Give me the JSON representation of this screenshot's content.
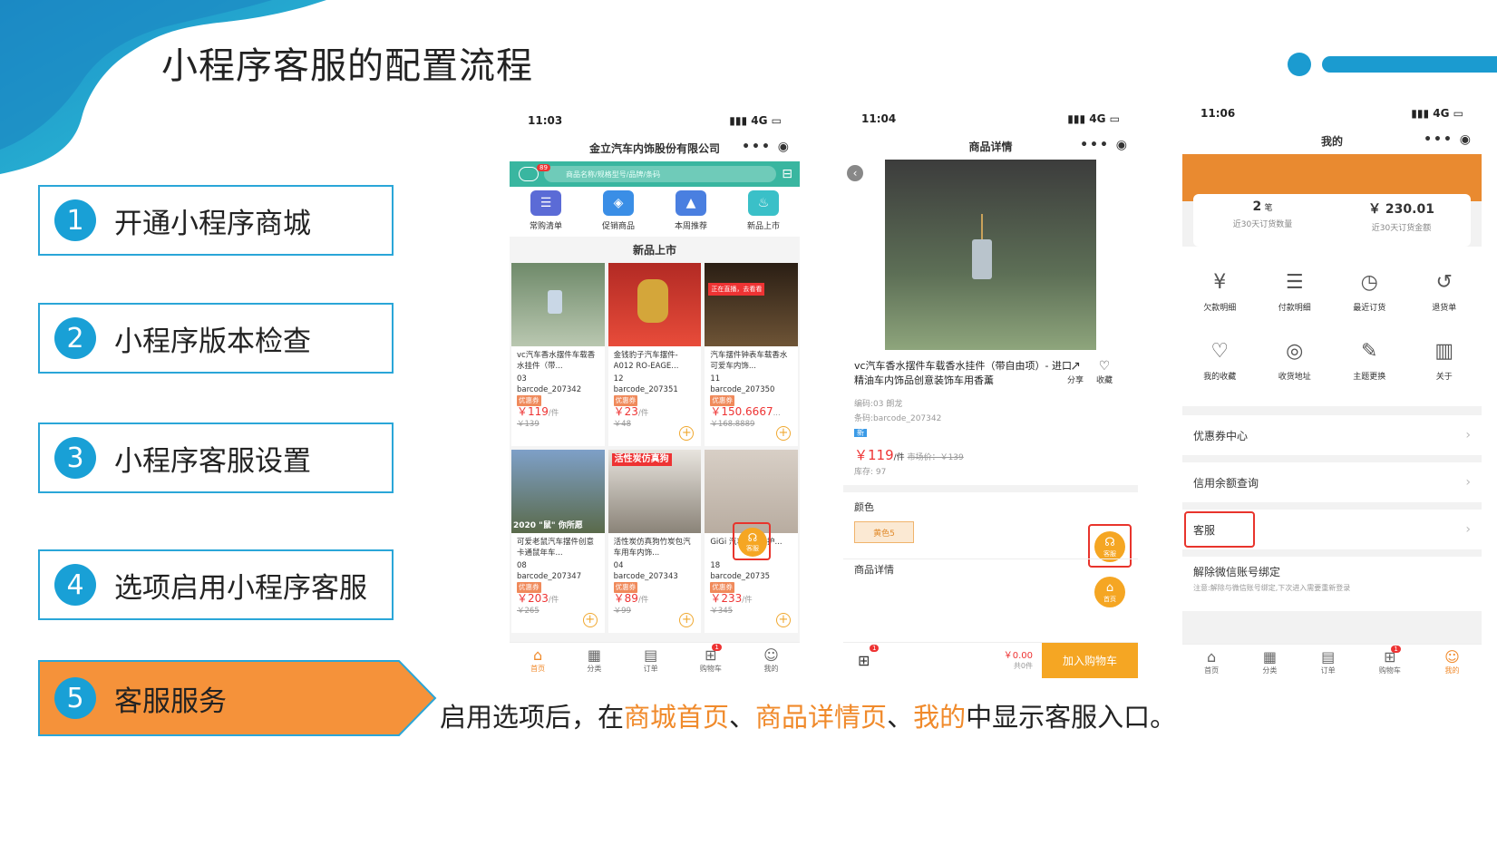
{
  "slide": {
    "title": "小程序客服的配置流程",
    "steps": [
      {
        "num": "1",
        "label": "开通小程序商城"
      },
      {
        "num": "2",
        "label": "小程序版本检查"
      },
      {
        "num": "3",
        "label": "小程序客服设置"
      },
      {
        "num": "4",
        "label": "选项启用小程序客服"
      },
      {
        "num": "5",
        "label": "客服服务"
      }
    ],
    "desc": {
      "part1": "启用选项后，在",
      "hl1": "商城首页",
      "sep1": "、",
      "hl2": "商品详情页",
      "sep2": "、",
      "hl3": "我的",
      "part2": "中显示客服入口。"
    },
    "colors": {
      "accent_blue": "#1b9bd0",
      "accent_orange": "#f08a2b",
      "highlight_red": "#e8342c"
    }
  },
  "phone1": {
    "time": "11:03",
    "signal": "4G",
    "shop_name": "金立汽车内饰股份有限公司",
    "msg_badge": "89",
    "search_placeholder": "商品名称/规格型号/品牌/条码",
    "quick_icons": [
      "常购清单",
      "促销商品",
      "本周推荐",
      "新品上市"
    ],
    "section_title": "新品上市",
    "live_label": "正在直播，去看看",
    "banner2020": "2020 \"鼠\" 你所愿",
    "banner_charcoal": "活性炭仿真狗",
    "products": [
      {
        "name": "vc汽车香水摆件车载香水挂件（带...",
        "code": "03",
        "barcode": "barcode_207342",
        "coupon": "优惠券",
        "price": "￥119",
        "unit": "/件",
        "old": "￥139"
      },
      {
        "name": "金钱豹子汽车摆件-A012 RO-EAGE...",
        "code": "12",
        "barcode": "barcode_207351",
        "coupon": "优惠券",
        "price": "￥23",
        "unit": "/件",
        "old": "￥48"
      },
      {
        "name": "汽车摆件钟表车载香水可爱车内饰...",
        "code": "11",
        "barcode": "barcode_207350",
        "coupon": "优惠券",
        "price": "￥150.6667",
        "unit": "...",
        "old": "￥168.8889"
      },
      {
        "name": "可爱老鼠汽车摆件创意卡通鼠年车...",
        "code": "08",
        "barcode": "barcode_207347",
        "coupon": "优惠券",
        "price": "￥203",
        "unit": "/件",
        "old": "￥265"
      },
      {
        "name": "活性炭仿真狗竹炭包汽车用车内饰...",
        "code": "04",
        "barcode": "barcode_207343",
        "coupon": "优惠券",
        "price": "￥89",
        "unit": "/件",
        "old": "￥99"
      },
      {
        "name": "GiGi 汽车...忆棉护...",
        "code": "18",
        "barcode": "barcode_20735",
        "coupon": "优惠券",
        "price": "￥233",
        "unit": "/件",
        "old": "￥345"
      }
    ],
    "kf_label": "客服",
    "tabs": [
      "首页",
      "分类",
      "订单",
      "购物车",
      "我的"
    ],
    "cart_badge": "1"
  },
  "phone2": {
    "time": "11:04",
    "signal": "4G",
    "nav_title": "商品详情",
    "product_name": "vc汽车香水摆件车载香水挂件（带自由项）- 进口精油车内饰品创意装饰车用香薰",
    "share": "分享",
    "fav": "收藏",
    "code_line": "编码:03 朗龙",
    "barcode_line": "条码:barcode_207342",
    "new_tag": "新",
    "price": "￥119",
    "unit": "/件",
    "market_price": "市场价：￥139",
    "stock": "库存: 97",
    "color_label": "颜色",
    "color_option": "黄色5",
    "kf_label": "客服",
    "home_label": "首页",
    "detail_label": "商品详情",
    "cart_badge": "1",
    "total": "￥0.00",
    "total_sub": "共0件",
    "add_cart": "加入购物车"
  },
  "phone3": {
    "time": "11:06",
    "signal": "4G",
    "nav_title": "我的",
    "stat1_value": "2",
    "stat1_unit": "笔",
    "stat1_label": "近30天订货数量",
    "stat2_value": "￥ 230.01",
    "stat2_label": "近30天订货金额",
    "grid": [
      {
        "label": "欠款明细",
        "icon": "yen-doc-icon"
      },
      {
        "label": "付款明细",
        "icon": "list-doc-icon"
      },
      {
        "label": "最近订货",
        "icon": "clock-doc-icon"
      },
      {
        "label": "退货单",
        "icon": "return-doc-icon"
      },
      {
        "label": "我的收藏",
        "icon": "heart-icon"
      },
      {
        "label": "收货地址",
        "icon": "location-icon"
      },
      {
        "label": "主题更换",
        "icon": "brush-icon"
      },
      {
        "label": "关于",
        "icon": "book-icon"
      }
    ],
    "rows": [
      "优惠券中心",
      "信用余额查询",
      "客服"
    ],
    "unbind_title": "解除微信账号绑定",
    "unbind_note": "注意:解除与微信账号绑定,下次进入需要重新登录",
    "tabs": [
      "首页",
      "分类",
      "订单",
      "购物车",
      "我的"
    ],
    "cart_badge": "1"
  }
}
